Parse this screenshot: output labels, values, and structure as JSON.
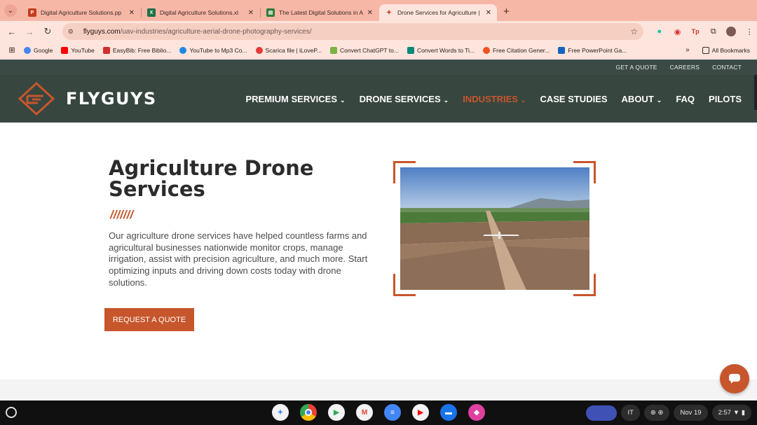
{
  "browser": {
    "tabs": [
      {
        "title": "Digital Agriculture Solutions.pp",
        "icon": "powerpoint-icon",
        "color": "#c43e1c",
        "active": false
      },
      {
        "title": "Digital Agriculture Solutions.xl",
        "icon": "excel-icon",
        "color": "#1e7145",
        "active": false
      },
      {
        "title": "The Latest Digital Solutions in A",
        "icon": "sheets-icon",
        "color": "#2e7d32",
        "active": false
      },
      {
        "title": "Drone Services for Agriculture |",
        "icon": "flyguys-icon",
        "color": "#c7562c",
        "active": true
      }
    ],
    "url_host": "flyguys.com",
    "url_path": "/uav-industries/agriculture-aerial-drone-photography-services/",
    "bookmarks": [
      {
        "label": "Google",
        "color": "#4285f4"
      },
      {
        "label": "YouTube",
        "color": "#ff0000"
      },
      {
        "label": "EasyBib: Free Biblio...",
        "color": "#d32f2f"
      },
      {
        "label": "YouTube to Mp3 Co...",
        "color": "#1e88e5"
      },
      {
        "label": "Scarica file | iLoveP...",
        "color": "#e53935"
      },
      {
        "label": "Convert ChatGPT to...",
        "color": "#7cb342"
      },
      {
        "label": "Convert Words to Ti...",
        "color": "#00897b"
      },
      {
        "label": "Free Citation Gener...",
        "color": "#f4511e"
      },
      {
        "label": "Free PowerPoint Ga...",
        "color": "#1565c0"
      }
    ],
    "all_bookmarks": "All Bookmarks"
  },
  "site": {
    "brand": "FLYGUYS",
    "accent": "#c7562c",
    "nav_bg": "#37463f",
    "utility_links": [
      "GET A QUOTE",
      "CAREERS",
      "CONTACT"
    ],
    "menu": [
      {
        "label": "PREMIUM SERVICES",
        "dropdown": true,
        "active": false
      },
      {
        "label": "DRONE SERVICES",
        "dropdown": true,
        "active": false
      },
      {
        "label": "INDUSTRIES",
        "dropdown": true,
        "active": true
      },
      {
        "label": "CASE STUDIES",
        "dropdown": false,
        "active": false
      },
      {
        "label": "ABOUT",
        "dropdown": true,
        "active": false
      },
      {
        "label": "FAQ",
        "dropdown": false,
        "active": false
      },
      {
        "label": "PILOTS",
        "dropdown": false,
        "active": false
      }
    ],
    "hero": {
      "title_line1": "Agriculture Drone",
      "title_line2": "Services",
      "slashes": "///////",
      "paragraph": "Our agriculture drone services have helped countless farms and agricultural businesses nationwide monitor crops, manage irrigation, assist with precision agriculture, and much more. Start optimizing inputs and driving down costs today with drone solutions.",
      "cta": "REQUEST A QUOTE"
    }
  },
  "os": {
    "language": "IT",
    "date": "Nov 19",
    "time": "2:57",
    "shelf_apps": [
      "gemini-icon",
      "chrome-icon",
      "play-store-icon",
      "gmail-icon",
      "docs-icon",
      "youtube-icon",
      "files-icon",
      "app-icon"
    ]
  }
}
